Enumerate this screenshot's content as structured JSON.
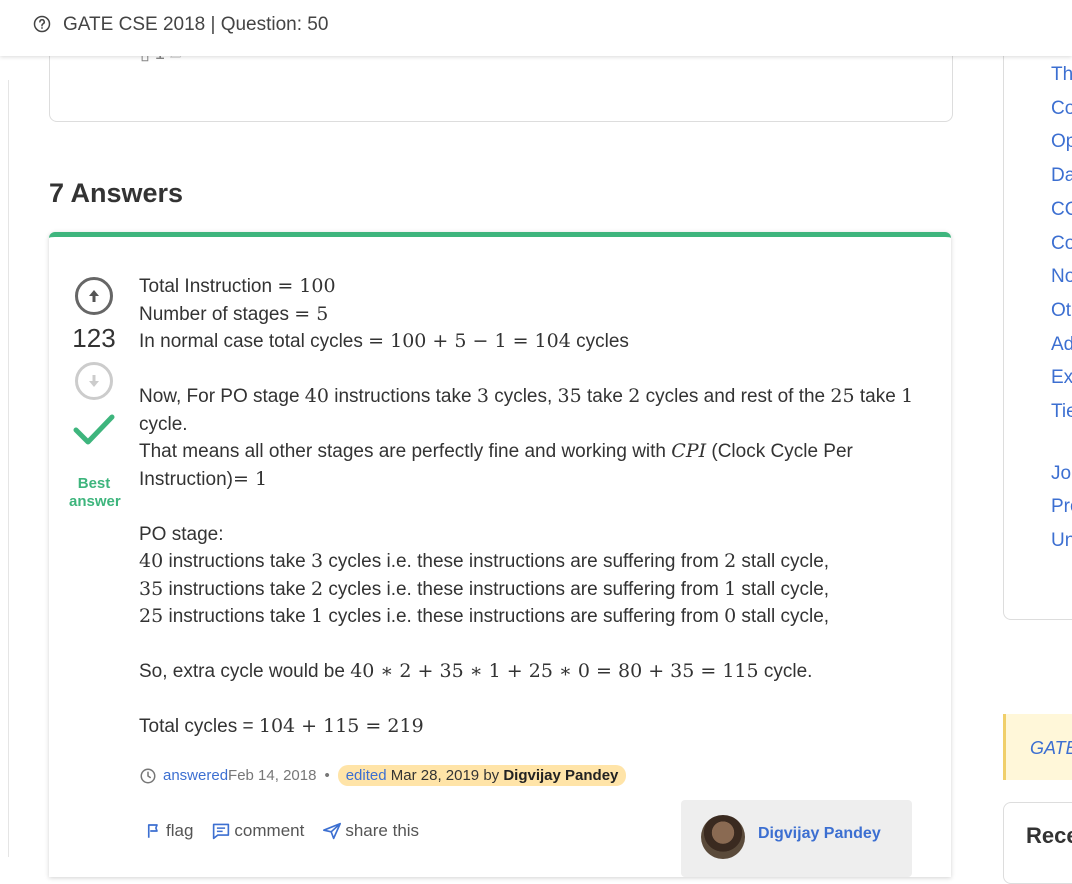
{
  "header": {
    "title": "GATE CSE 2018 | Question: 50"
  },
  "question_card": {
    "vote_fragment": "1"
  },
  "answers": {
    "heading": "7 Answers"
  },
  "answer": {
    "votes": "123",
    "best_label_1": "Best",
    "best_label_2": "answer",
    "lines": {
      "l1_text": "Total Instruction ",
      "l1_math": "= 100",
      "l2_text": "Number of stages ",
      "l2_math": "= 5",
      "l3_text": "In normal case total cycles ",
      "l3_math": "= 100 + 5 − 1 = 104",
      "l3_tail": " cycles",
      "l4_a": "Now, For PO stage ",
      "l4_m1": "40",
      "l4_b": " instructions take ",
      "l4_m2": "3",
      "l4_c": " cycles, ",
      "l4_m3": "35",
      "l4_d": " take ",
      "l4_m4": "2",
      "l4_e": " cycles and rest of the ",
      "l4_m5": "25",
      "l4_f": " take ",
      "l4_m6": "1",
      "l4_g": "cycle.",
      "l5_a": "That means all other stages are perfectly fine and working with ",
      "l5_m": "CPI",
      "l5_b": " (Clock Cycle Per",
      "l5_c": "Instruction)",
      "l5_m2": "= 1",
      "l6": "PO stage:",
      "l7_m1": "40",
      "l7_a": " instructions take ",
      "l7_m2": "3",
      "l7_b": " cycles i.e. these instructions are suffering from ",
      "l7_m3": "2",
      "l7_c": " stall cycle,",
      "l8_m1": "35",
      "l8_a": " instructions take ",
      "l8_m2": "2",
      "l8_b": " cycles i.e. these instructions are suffering from ",
      "l8_m3": "1",
      "l8_c": " stall cycle,",
      "l9_m1": "25",
      "l9_a": " instructions take ",
      "l9_m2": "1",
      "l9_b": " cycles i.e. these instructions are suffering from ",
      "l9_m3": "0",
      "l9_c": " stall cycle,",
      "l10_a": "So, extra cycle would be ",
      "l10_m": "40 ∗ 2 + 35 ∗ 1 + 25 ∗ 0 = 80 + 35 = 115",
      "l10_b": " cycle.",
      "l11_a": "Total cycles = ",
      "l11_m": "104 + 115 = 219"
    },
    "meta": {
      "answered": "answered",
      "answered_date": " Feb 14, 2018",
      "edited": "edited",
      "edited_date": " Mar 28, 2019 by ",
      "editor": "Digvijay Pandey"
    },
    "actions": {
      "flag": "flag",
      "comment": "comment",
      "share": "share this"
    },
    "user": {
      "name": "Digvijay Pandey"
    }
  },
  "sidebar": {
    "items": [
      "Th",
      "Co",
      "Op",
      "Da",
      "CO",
      "Co",
      "No",
      "Oth",
      "Ad",
      "Ex",
      "Tie",
      "Jo",
      "Pro",
      "Un"
    ]
  },
  "gate_box": {
    "label": "GATE"
  },
  "recent_box": {
    "label": "Rece"
  },
  "colors": {
    "accent_green": "#3eb57d",
    "link_blue": "#3c6fd1",
    "edited_bg": "#ffe4a8"
  }
}
